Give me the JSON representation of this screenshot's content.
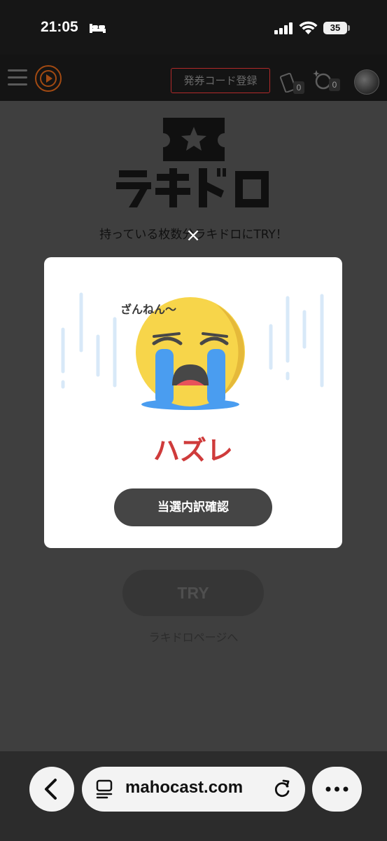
{
  "status_bar": {
    "time": "21:05",
    "battery": "35"
  },
  "header": {
    "register_button": "発券コード登録",
    "ticket_count": "0",
    "gem_count": "0"
  },
  "page": {
    "logo_text": "ラキドロ",
    "description": "持っている枚数分ラキドロにTRY！",
    "try_button": "TRY",
    "page_link": "ラキドロページへ"
  },
  "modal": {
    "close": "×",
    "emoji_caption": "ざんねん〜",
    "result": "ハズレ",
    "confirm_button": "当選内訳確認"
  },
  "browser": {
    "url": "mahocast.com"
  },
  "colors": {
    "overlay": "#3f3f3f",
    "result_red": "#cf3b3b",
    "emoji_yellow": "#f7d54a",
    "tear_blue": "#4a9df0",
    "register_border": "#b22a2a"
  },
  "icons": [
    "bed-icon",
    "signal-icon",
    "wifi-icon",
    "battery-icon",
    "hamburger-menu-icon",
    "play-logo-icon",
    "ticket-icon",
    "gem-icon",
    "crying-emoji-icon",
    "close-icon",
    "chevron-left-icon",
    "tabs-icon",
    "reload-icon",
    "more-icon"
  ]
}
